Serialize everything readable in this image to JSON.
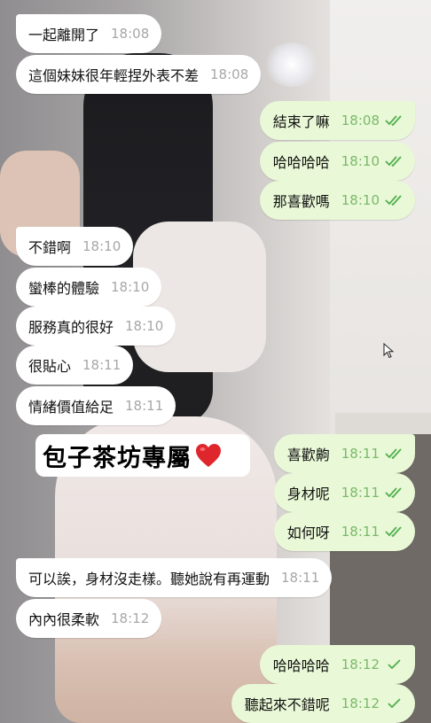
{
  "messages": [
    {
      "dir": "in",
      "text": "一起離開了",
      "time": "18:08"
    },
    {
      "dir": "in",
      "text": "這個妹妹很年輕捏外表不差",
      "time": "18:08"
    },
    {
      "dir": "out",
      "text": "結束了嘛",
      "time": "18:08"
    },
    {
      "dir": "out",
      "text": "哈哈哈哈",
      "time": "18:10"
    },
    {
      "dir": "out",
      "text": "那喜歡嗎",
      "time": "18:10"
    },
    {
      "dir": "in",
      "text": "不錯啊",
      "time": "18:10"
    },
    {
      "dir": "in",
      "text": "蠻棒的體驗",
      "time": "18:10"
    },
    {
      "dir": "in",
      "text": "服務真的很好",
      "time": "18:10"
    },
    {
      "dir": "in",
      "text": "很貼心",
      "time": "18:11"
    },
    {
      "dir": "in",
      "text": "情緒價值給足",
      "time": "18:11"
    },
    {
      "dir": "out",
      "text": "喜歡齁",
      "time": "18:11"
    },
    {
      "dir": "out",
      "text": "身材呢",
      "time": "18:11"
    },
    {
      "dir": "out",
      "text": "如何呀",
      "time": "18:11"
    },
    {
      "dir": "in",
      "text": "可以誒，身材沒走樣。聽她說有再運動",
      "time": "18:11"
    },
    {
      "dir": "in",
      "text": "內內很柔軟",
      "time": "18:12"
    },
    {
      "dir": "out",
      "text": "哈哈哈哈",
      "time": "18:12"
    },
    {
      "dir": "out",
      "text": "聽起來不錯呢",
      "time": "18:12"
    }
  ],
  "status_icons": {
    "read": "double-check-icon",
    "delivered": "single-check-icon"
  },
  "sticker": {
    "text": "包子茶坊專屬",
    "icon": "heart-icon"
  },
  "colors": {
    "incoming": "#ffffff",
    "outgoing": "#e9f8d6",
    "check": "#4fae4e",
    "heart": "#e0262d"
  }
}
